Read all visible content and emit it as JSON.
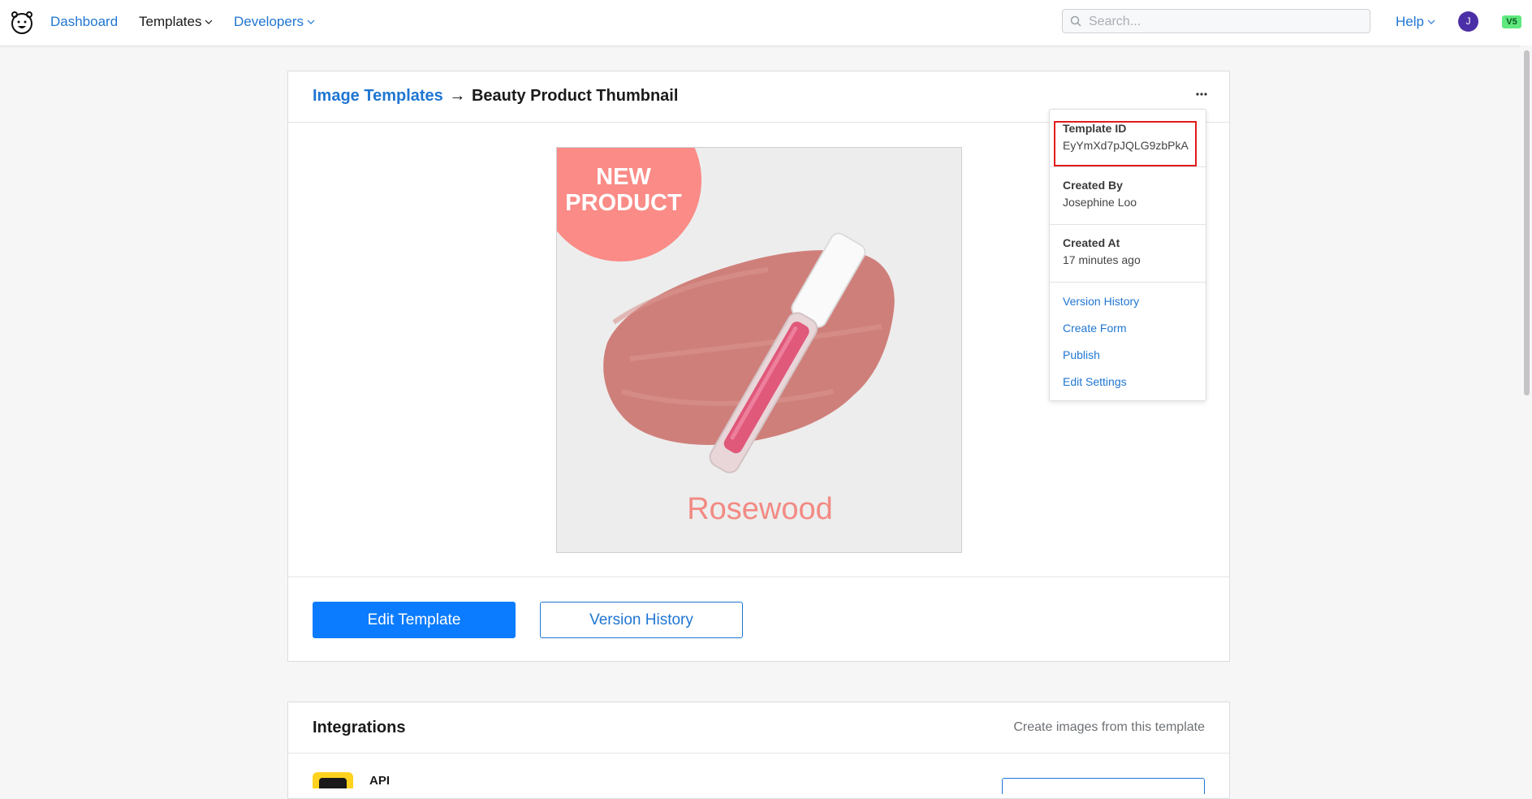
{
  "nav": {
    "dashboard": "Dashboard",
    "templates": "Templates",
    "developers": "Developers",
    "search_placeholder": "Search...",
    "help": "Help",
    "avatar_initial": "J",
    "version_badge": "V5"
  },
  "breadcrumb": {
    "parent": "Image Templates",
    "arrow": "→",
    "current": "Beauty Product Thumbnail"
  },
  "preview": {
    "badge_line1": "NEW",
    "badge_line2": "PRODUCT",
    "product_name": "Rosewood"
  },
  "actions": {
    "edit_template": "Edit Template",
    "version_history": "Version History"
  },
  "menu": {
    "template_id_label": "Template ID",
    "template_id_value": "EyYmXd7pJQLG9zbPkA",
    "created_by_label": "Created By",
    "created_by_value": "Josephine Loo",
    "created_at_label": "Created At",
    "created_at_value": "17 minutes ago",
    "links": [
      "Version History",
      "Create Form",
      "Publish",
      "Edit Settings"
    ]
  },
  "integrations": {
    "title": "Integrations",
    "subtitle": "Create images from this template",
    "first_item": "API"
  },
  "colors": {
    "brand_blue": "#0b7cff",
    "link_blue": "#1f76d2",
    "highlight_red": "#e11b1b",
    "promo_pink": "#fa8b86"
  }
}
